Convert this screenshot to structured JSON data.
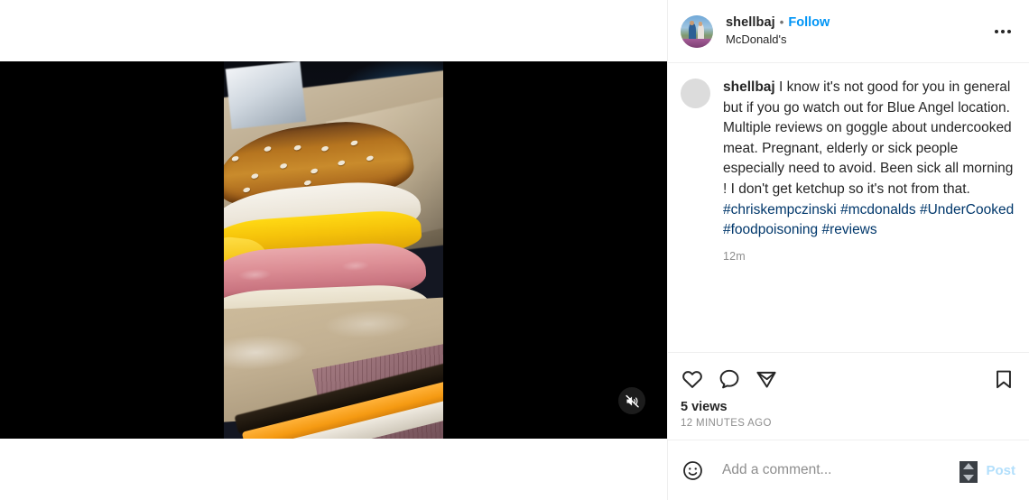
{
  "post": {
    "author_username": "shellbaj",
    "separator": "•",
    "follow_label": "Follow",
    "location": "McDonald's",
    "options_label": "More options",
    "avatar_alt": "shellbaj profile photo"
  },
  "caption": {
    "username": "shellbaj",
    "body_before_tags": " I know it's not good for you in general but if you go watch out for Blue Angel location. Multiple reviews on goggle about undercooked meat. Pregnant, elderly or sick people especially need to avoid. Been sick all morning ! I don't get ketchup so it's not from that. ",
    "hashtags": [
      "#chriskempczinski",
      "#mcdonalds",
      "#UnderCooked",
      "#foodpoisoning",
      "#reviews"
    ],
    "timestamp": "12m"
  },
  "actions": {
    "like_icon": "heart-icon",
    "comment_icon": "comment-bubble-icon",
    "share_icon": "share-paper-plane-icon",
    "save_icon": "bookmark-icon",
    "views_count": "5 views",
    "posted_ago": "12 MINUTES AGO"
  },
  "comment_box": {
    "emoji_icon": "emoji-smiley-icon",
    "placeholder": "Add a comment...",
    "post_label": "Post"
  },
  "media": {
    "mute_icon": "speaker-muted-icon",
    "mute_label": "Audio is muted"
  },
  "colors": {
    "accent_blue": "#0095f6",
    "hashtag_blue": "#00376b",
    "post_disabled": "#b2dffc",
    "primary_text": "#262626",
    "secondary_text": "#8e8e8e",
    "divider": "#efefef",
    "media_backdrop": "#000000"
  }
}
